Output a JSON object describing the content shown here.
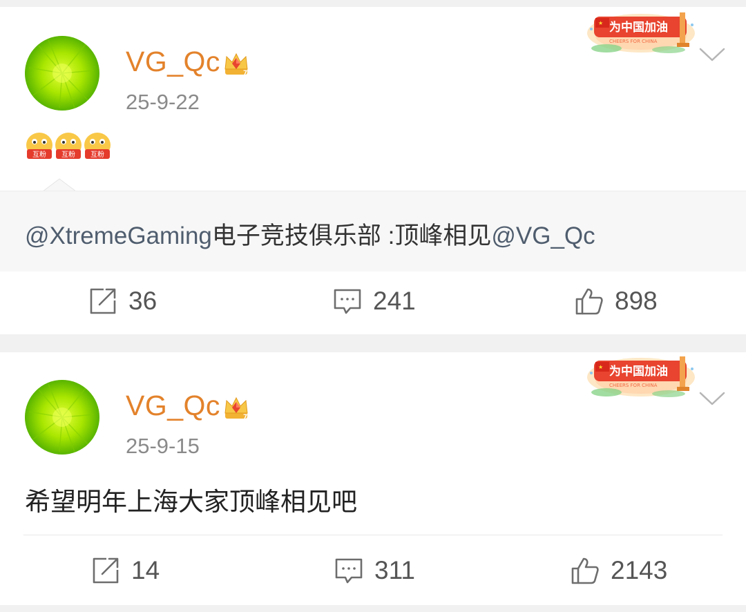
{
  "colors": {
    "username": "#e3822b",
    "date": "#8a8a8a",
    "mention": "#4f5d6e",
    "avatar_green": "#9fe000",
    "badge_red": "#e8442f"
  },
  "badge": {
    "title": "为中国加油",
    "subtitle": "CHEERS FOR CHINA"
  },
  "posts": [
    {
      "username": "VG_Qc",
      "date": "25-9-22",
      "emoji_label": "互粉",
      "repost": {
        "mention": "@XtremeGaming",
        "text": "电子竞技俱乐部 :顶峰相见",
        "tail_mention": "@VG_Qc"
      },
      "actions": {
        "repost_count": "36",
        "comment_count": "241",
        "like_count": "898"
      },
      "icons": [
        "crown-icon",
        "chevron-down-icon",
        "share-icon",
        "comment-icon",
        "like-icon"
      ]
    },
    {
      "username": "VG_Qc",
      "date": "25-9-15",
      "text": "希望明年上海大家顶峰相见吧",
      "actions": {
        "repost_count": "14",
        "comment_count": "311",
        "like_count": "2143"
      },
      "icons": [
        "crown-icon",
        "chevron-down-icon",
        "share-icon",
        "comment-icon",
        "like-icon"
      ]
    }
  ]
}
